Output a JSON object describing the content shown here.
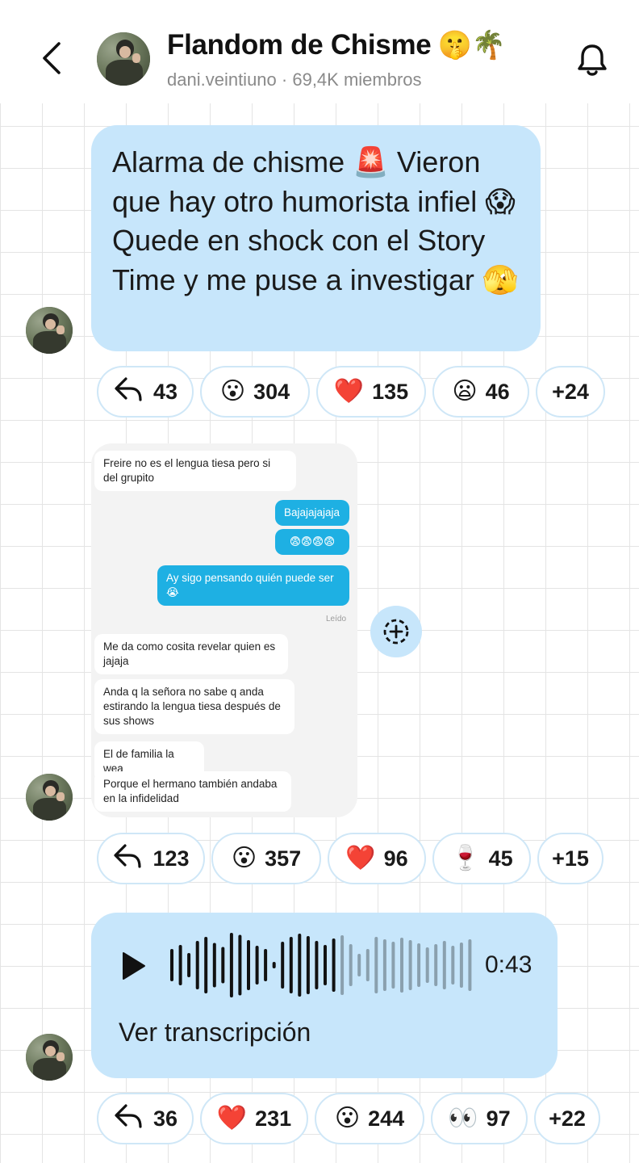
{
  "header": {
    "title": "Flandom de Chisme",
    "title_emojis": "🤫🌴",
    "owner": "dani.veintiuno",
    "members": "69,4K miembros",
    "separator": " · "
  },
  "messages": [
    {
      "text": "Alarma de chisme 🚨 Vieron que hay otro humorista infiel 😱 Quede en shock con el Story Time y me puse a investigar 🫣",
      "reactions": [
        {
          "icon": "↰",
          "icon_name": "reply-icon",
          "count": "43"
        },
        {
          "icon": "😮",
          "icon_name": "surprised-face-icon",
          "count": "304"
        },
        {
          "icon": "❤️",
          "icon_name": "heart-icon",
          "count": "135"
        },
        {
          "icon": "😦",
          "icon_name": "frowning-face-icon",
          "count": "46"
        },
        {
          "icon": "",
          "icon_name": "more-reactions",
          "count": "+24"
        }
      ]
    },
    {
      "screenshot": {
        "bubbles": [
          {
            "side": "in",
            "text": "Freire no es el lengua tiesa pero si del grupito"
          },
          {
            "side": "out",
            "text": "Bajajajajaja"
          },
          {
            "side": "out",
            "text": "😨😨😨😨"
          },
          {
            "side": "out",
            "text": "Ay sigo pensando quién puede ser 😭"
          },
          {
            "side": "in",
            "text": "Me da como cosita revelar quien es jajaja"
          },
          {
            "side": "in",
            "text": "Anda q la señora no sabe q anda estirando la lengua tiesa después de sus shows"
          },
          {
            "side": "in",
            "text": "El de familia la wea"
          },
          {
            "side": "in",
            "text": "Porque el hermano también andaba en la infidelidad"
          }
        ],
        "read_label": "Leído"
      },
      "reactions": [
        {
          "icon": "↰",
          "icon_name": "reply-icon",
          "count": "123"
        },
        {
          "icon": "😮",
          "icon_name": "surprised-face-icon",
          "count": "357"
        },
        {
          "icon": "❤️",
          "icon_name": "heart-icon",
          "count": "96"
        },
        {
          "icon": "🍷",
          "icon_name": "wine-glass-icon",
          "count": "45"
        },
        {
          "icon": "",
          "icon_name": "more-reactions",
          "count": "+15"
        }
      ]
    },
    {
      "voice": {
        "duration": "0:43",
        "transcript_label": "Ver transcripción",
        "played_fraction": 0.55
      },
      "reactions": [
        {
          "icon": "↰",
          "icon_name": "reply-icon",
          "count": "36"
        },
        {
          "icon": "❤️",
          "icon_name": "heart-icon",
          "count": "231"
        },
        {
          "icon": "😮",
          "icon_name": "surprised-face-icon",
          "count": "244"
        },
        {
          "icon": "👀",
          "icon_name": "eyes-icon",
          "count": "97"
        },
        {
          "icon": "",
          "icon_name": "more-reactions",
          "count": "+22"
        }
      ]
    }
  ],
  "colors": {
    "bubble": "#c7e6fb",
    "chip_border": "#cfe7f7",
    "outgoing_dm": "#1eb0e3",
    "muted_text": "#8a8a8a"
  }
}
